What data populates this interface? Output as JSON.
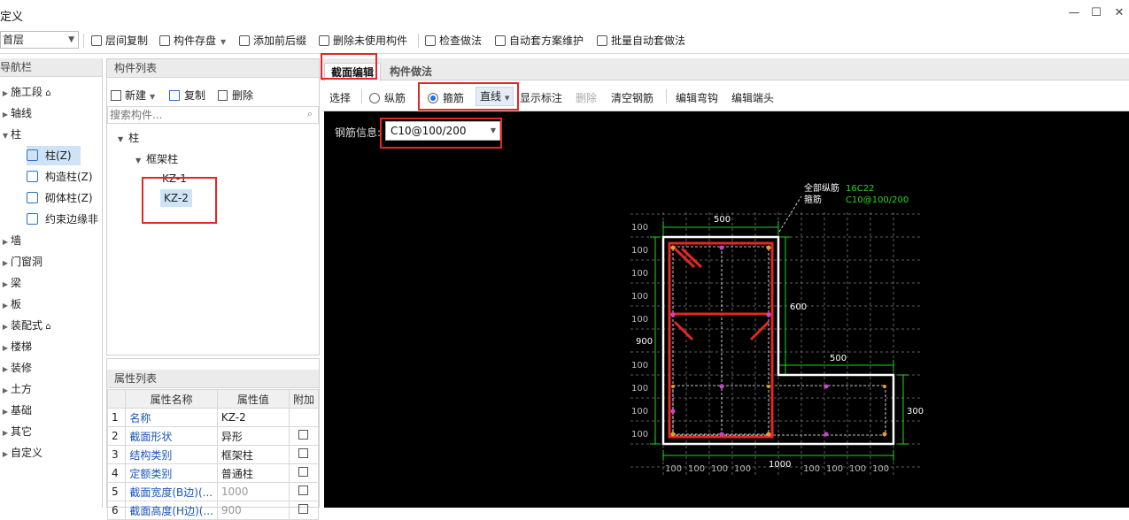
{
  "window": {
    "title": "定义",
    "min": "—",
    "max": "☐",
    "close": "✕"
  },
  "toolbar": {
    "floor": "首层",
    "buttons": [
      "层间复制",
      "构件存盘",
      "添加前后缀",
      "删除未使用构件",
      "检查做法",
      "自动套方案维护",
      "批量自动套做法"
    ]
  },
  "nav": {
    "header": "导航栏",
    "items": [
      "施工段",
      "轴线",
      "柱",
      "墙",
      "门窗洞",
      "梁",
      "板",
      "装配式",
      "楼梯",
      "装修",
      "土方",
      "基础",
      "其它",
      "自定义"
    ],
    "sub_items": [
      "柱(Z)",
      "构造柱(Z)",
      "砌体柱(Z)",
      "约束边缘非"
    ]
  },
  "components": {
    "header": "构件列表",
    "new_label": "新建",
    "copy_label": "复制",
    "delete_label": "删除",
    "search_placeholder": "搜索构件...",
    "tree_root": "柱",
    "tree_group": "框架柱",
    "tree_items": [
      "KZ-1",
      "KZ-2"
    ]
  },
  "properties": {
    "header": "属性列表",
    "columns": [
      "属性名称",
      "属性值",
      "附加"
    ],
    "rows": [
      {
        "no": "1",
        "name": "名称",
        "value": "KZ-2"
      },
      {
        "no": "2",
        "name": "截面形状",
        "value": "异形"
      },
      {
        "no": "3",
        "name": "结构类别",
        "value": "框架柱"
      },
      {
        "no": "4",
        "name": "定额类别",
        "value": "普通柱"
      },
      {
        "no": "5",
        "name": "截面宽度(B边)(...",
        "value": "1000"
      },
      {
        "no": "6",
        "name": "截面高度(H边)(...",
        "value": "900"
      }
    ]
  },
  "tabs": [
    "截面编辑",
    "构件做法"
  ],
  "section_toolbar": {
    "select": "选择",
    "longitudinal": "纵筋",
    "stirrup": "箍筋",
    "line_mode": "直线",
    "show_label": "显示标注",
    "delete": "删除",
    "clear": "清空钢筋",
    "edit_hook": "编辑弯钩",
    "edit_end": "编辑端头"
  },
  "canvas": {
    "rebar_info_label": "钢筋信息:",
    "rebar_info_value": "C10@100/200",
    "note_all_rebar_label": "全部纵筋",
    "note_all_rebar_value": "16C22",
    "note_stirrup_label": "箍筋",
    "note_stirrup_value": "C10@100/200",
    "dims": {
      "top": "500",
      "right_upper": "600",
      "left": "900",
      "mid": "500",
      "right_lower": "300",
      "bottom": "1000",
      "grid": "100"
    }
  },
  "colors": {
    "highlight": "#e32626",
    "accent": "#1a73e8",
    "link": "#1a56b8",
    "dim_green": "#22d922"
  }
}
